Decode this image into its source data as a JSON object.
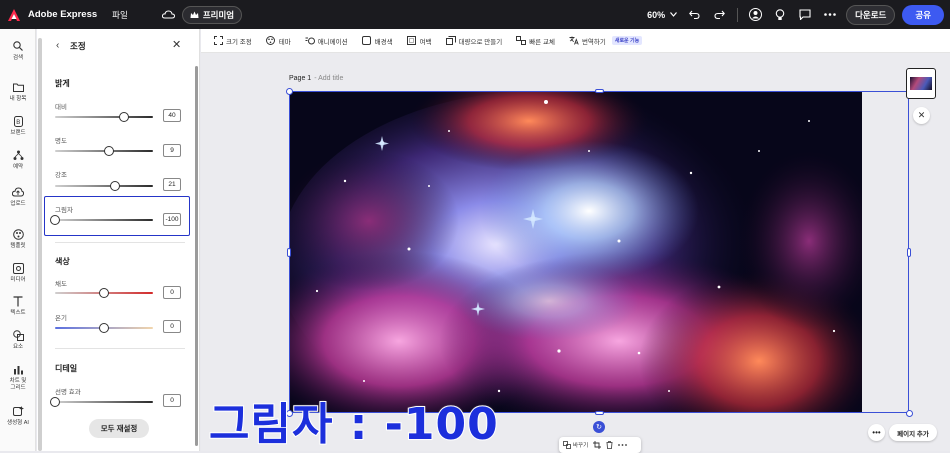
{
  "topbar": {
    "app_name": "Adobe Express",
    "file_label": "파일",
    "premium_label": "프리미엄",
    "zoom": "60%",
    "download_label": "다운로드",
    "share_label": "공유"
  },
  "rail": {
    "items": [
      {
        "label": "검색",
        "icon": "search-icon"
      },
      {
        "label": "내 항목",
        "icon": "folder-icon"
      },
      {
        "label": "브랜드",
        "icon": "brand-icon"
      },
      {
        "label": "예약",
        "icon": "schedule-icon"
      },
      {
        "label": "업로드",
        "icon": "upload-icon"
      },
      {
        "label": "템플릿",
        "icon": "template-icon"
      },
      {
        "label": "미디어",
        "icon": "media-icon"
      },
      {
        "label": "텍스트",
        "icon": "text-icon"
      },
      {
        "label": "요소",
        "icon": "elements-icon"
      },
      {
        "label": "차트 및\n그리드",
        "icon": "chart-icon"
      },
      {
        "label": "생성형 AI",
        "icon": "ai-icon"
      }
    ]
  },
  "panel": {
    "title": "조정",
    "sections": {
      "light": "밝게",
      "color": "색상",
      "detail": "디테일"
    },
    "sliders": {
      "contrast": {
        "label": "대비",
        "value": "40",
        "fraction": 0.7
      },
      "brightness": {
        "label": "명도",
        "value": "9",
        "fraction": 0.55
      },
      "highlights": {
        "label": "강조",
        "value": "21",
        "fraction": 0.61
      },
      "shadows": {
        "label": "그림자",
        "value": "-100",
        "fraction": 0.0
      },
      "saturation": {
        "label": "채도",
        "value": "0",
        "fraction": 0.5
      },
      "temperature": {
        "label": "온기",
        "value": "0",
        "fraction": 0.5
      },
      "sharpness": {
        "label": "선명 효과",
        "value": "0",
        "fraction": 0.0
      }
    },
    "reset_label": "모두 재설정"
  },
  "toolbar": {
    "items": [
      {
        "label": "크기 조정",
        "icon": "resize-icon"
      },
      {
        "label": "테마",
        "icon": "theme-icon"
      },
      {
        "label": "애니메이션",
        "icon": "animation-icon"
      },
      {
        "label": "배경색",
        "icon": "background-icon"
      },
      {
        "label": "여백",
        "icon": "margin-icon"
      },
      {
        "label": "대량으로 만들기",
        "icon": "bulk-create-icon"
      },
      {
        "label": "빠른 교체",
        "icon": "quick-swap-icon"
      },
      {
        "label": "번역하기",
        "icon": "translate-icon"
      }
    ],
    "new_badge": "새로운 기능"
  },
  "canvas": {
    "page_label": "Page 1",
    "page_subtitle": "- Add title",
    "context_replace": "바꾸기",
    "add_page_label": "페이지 추가",
    "overlay_text": "그림자 : -100"
  },
  "colors": {
    "accent": "#3d5af1",
    "selection": "#3a4fd6",
    "overlay_text": "#1c2fdc"
  }
}
